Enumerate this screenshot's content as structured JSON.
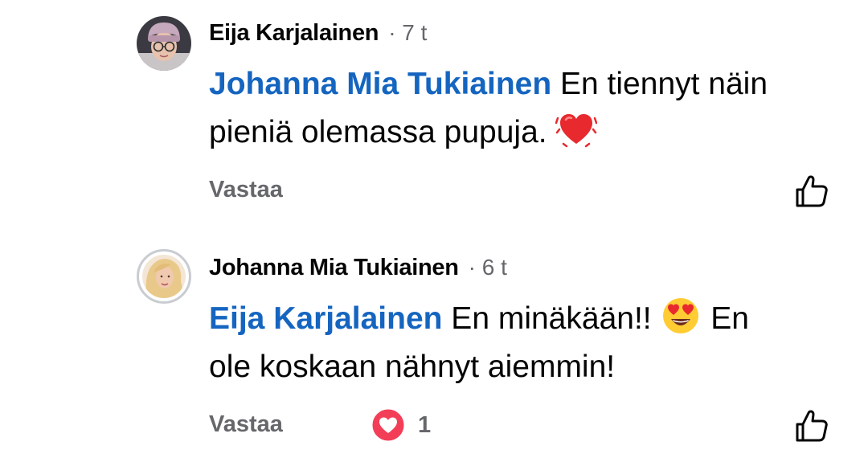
{
  "comments": [
    {
      "author": "Eija Karjalainen",
      "separator": "·",
      "time": "7 t",
      "mention": "Johanna Mia Tukiainen",
      "text_line1": " En tiennyt näin",
      "text_line2": "pieniä olemassa pupuja. ",
      "emoji": "vibrating-heart",
      "reply_label": "Vastaa"
    },
    {
      "author": "Johanna Mia Tukiainen",
      "separator": "·",
      "time": "6 t",
      "mention": "Eija Karjalainen",
      "text_part1": " En minäkään!! ",
      "emoji": "heart-eyes",
      "text_part2": " En",
      "text_line2": "ole koskaan nähnyt aiemmin!",
      "reply_label": "Vastaa",
      "reaction": {
        "icon": "heart-reaction-icon",
        "count": "1"
      }
    }
  ],
  "colors": {
    "mention": "#1565c0",
    "meta": "#65676b",
    "text": "#050505",
    "reaction": "#f33e58"
  }
}
